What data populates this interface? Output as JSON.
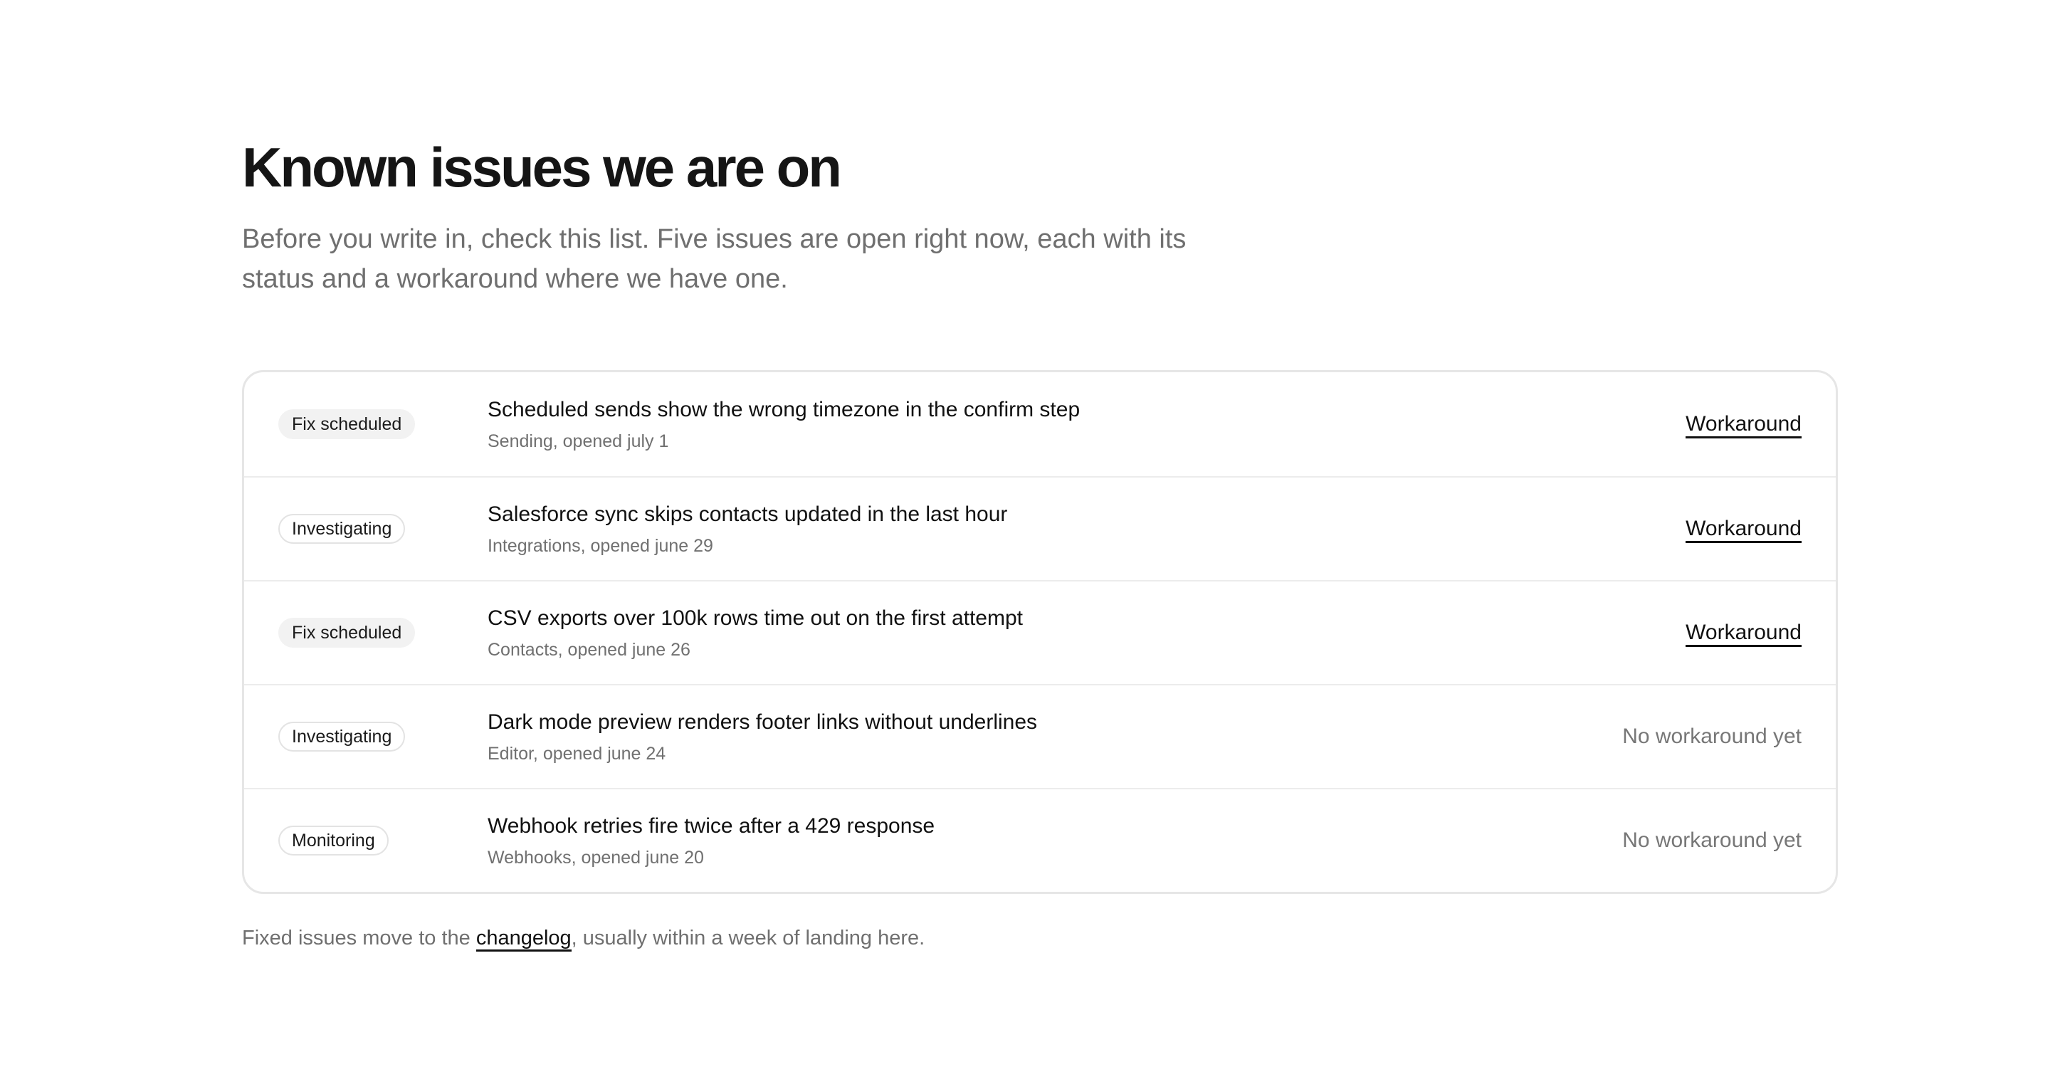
{
  "header": {
    "title": "Known issues we are on",
    "intro": "Before you write in, check this list. Five issues are open right now, each with its status and a workaround where we have one."
  },
  "issues": [
    {
      "status": "Fix scheduled",
      "title": "Scheduled sends show the wrong timezone in the confirm step",
      "meta": "Sending, opened july 1",
      "action": "Workaround"
    },
    {
      "status": "Investigating",
      "title": "Salesforce sync skips contacts updated in the last hour",
      "meta": "Integrations, opened june 29",
      "action": "Workaround"
    },
    {
      "status": "Fix scheduled",
      "title": "CSV exports over 100k rows time out on the first attempt",
      "meta": "Contacts, opened june 26",
      "action": "Workaround"
    },
    {
      "status": "Investigating",
      "title": "Dark mode preview renders footer links without underlines",
      "meta": "Editor, opened june 24",
      "action": "No workaround yet"
    },
    {
      "status": "Monitoring",
      "title": "Webhook retries fire twice after a 429 response",
      "meta": "Webhooks, opened june 20",
      "action": "No workaround yet"
    }
  ],
  "footer": {
    "prefix": "Fixed issues move to the ",
    "link": "changelog",
    "suffix": ", usually within a week of landing here."
  }
}
